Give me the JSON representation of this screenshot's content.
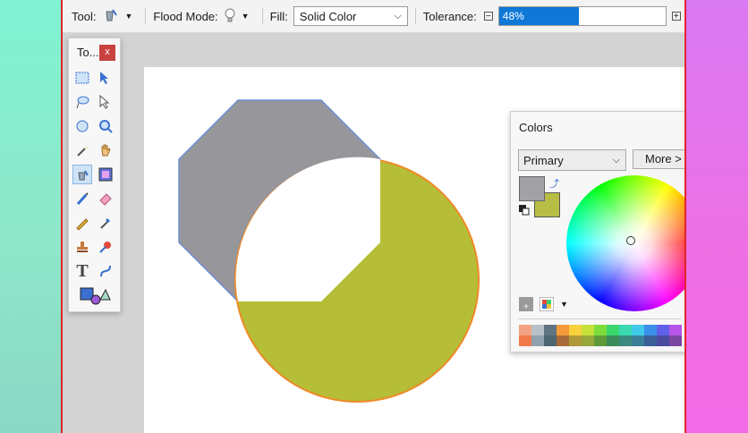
{
  "toolbar": {
    "tool_label": "Tool:",
    "flood_mode_label": "Flood Mode:",
    "fill_label": "Fill:",
    "fill_value": "Solid Color",
    "tolerance_label": "Tolerance:",
    "tolerance_text": "48%",
    "tolerance_value": 0.48
  },
  "tools_panel": {
    "title": "To...",
    "close": "x",
    "text_tool_glyph": "T"
  },
  "colors_panel": {
    "title": "Colors",
    "primary_select": "Primary",
    "more_button": "More >",
    "primary_color": "#a1a1a6",
    "secondary_color": "#b8bd45",
    "palette": [
      "#f4a285",
      "#b8c0c8",
      "#5f7480",
      "#f49a3a",
      "#f7d23c",
      "#c7e13a",
      "#7ddd3c",
      "#3bd66c",
      "#3bd9b0",
      "#40c9e8",
      "#3a8fe8",
      "#6060e8",
      "#b656e8",
      "#f07a4a",
      "#8fa2ad",
      "#4d6670",
      "#a86b3a",
      "#b09a3a",
      "#96a83a",
      "#5e9a3a",
      "#3a8a5a",
      "#3a8a7e",
      "#3a7f99",
      "#3a5f99",
      "#4a4aa0",
      "#7a46a0"
    ]
  },
  "shapes": {
    "octagon_fill": "#96969b",
    "octagon_stroke": "#6f8fd6",
    "circle_fill": "#b6bd37",
    "circle_stroke": "#ef8a28"
  }
}
